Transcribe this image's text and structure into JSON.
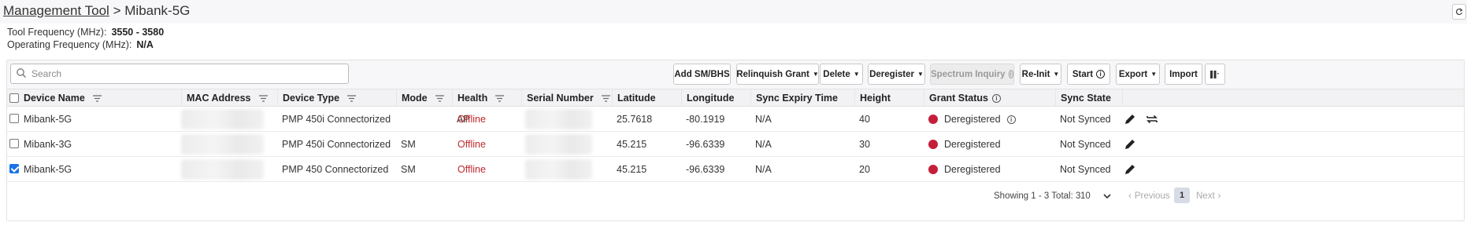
{
  "breadcrumb": {
    "root": "Management Tool",
    "separator": ">",
    "current": "Mibank-5G"
  },
  "info": {
    "tool_frequency_label": "Tool Frequency (MHz):",
    "tool_frequency_value": "3550 - 3580",
    "operating_frequency_label": "Operating Frequency (MHz):",
    "operating_frequency_value": "N/A"
  },
  "search": {
    "placeholder": "Search",
    "value": ""
  },
  "toolbar": {
    "add": "Add SM/BHS",
    "relinquish": "Relinquish Grant",
    "delete": "Delete",
    "deregister": "Deregister",
    "spectrum": "Spectrum Inquiry",
    "reinit": "Re-Init",
    "start": "Start",
    "export": "Export",
    "import": "Import"
  },
  "columns": {
    "device_name": "Device Name",
    "mac": "MAC Address",
    "device_type": "Device Type",
    "mode": "Mode",
    "health": "Health",
    "serial": "Serial Number",
    "latitude": "Latitude",
    "longitude": "Longitude",
    "sync_expiry": "Sync Expiry Time",
    "height": "Height",
    "grant_status": "Grant Status",
    "sync_state": "Sync State"
  },
  "rows": [
    {
      "checked": false,
      "device_name": "Mibank-5G",
      "device_type": "PMP 450i Connectorized",
      "mode": "AP",
      "health": "Offline",
      "latitude": "25.7618",
      "longitude": "-80.1919",
      "sync_expiry": "N/A",
      "height": "40",
      "grant_status": "Deregistered",
      "sync_state": "Not Synced"
    },
    {
      "checked": false,
      "device_name": "Mibank-3G",
      "device_type": "PMP 450i Connectorized",
      "mode": "SM",
      "health": "Offline",
      "latitude": "45.215",
      "longitude": "-96.6339",
      "sync_expiry": "N/A",
      "height": "30",
      "grant_status": "Deregistered",
      "sync_state": "Not Synced"
    },
    {
      "checked": true,
      "device_name": "Mibank-5G",
      "device_type": "PMP 450 Connectorized",
      "mode": "SM",
      "health": "Offline",
      "latitude": "45.215",
      "longitude": "-96.6339",
      "sync_expiry": "N/A",
      "height": "20",
      "grant_status": "Deregistered",
      "sync_state": "Not Synced"
    }
  ],
  "pagination": {
    "showing": "Showing 1 - 3 Total: 3",
    "page_size": "10",
    "previous": "Previous",
    "current_page": "1",
    "next": "Next"
  },
  "colors": {
    "offline": "#c0292f",
    "deregistered_dot": "#c41e3a",
    "checkbox_checked": "#1a73e8"
  }
}
